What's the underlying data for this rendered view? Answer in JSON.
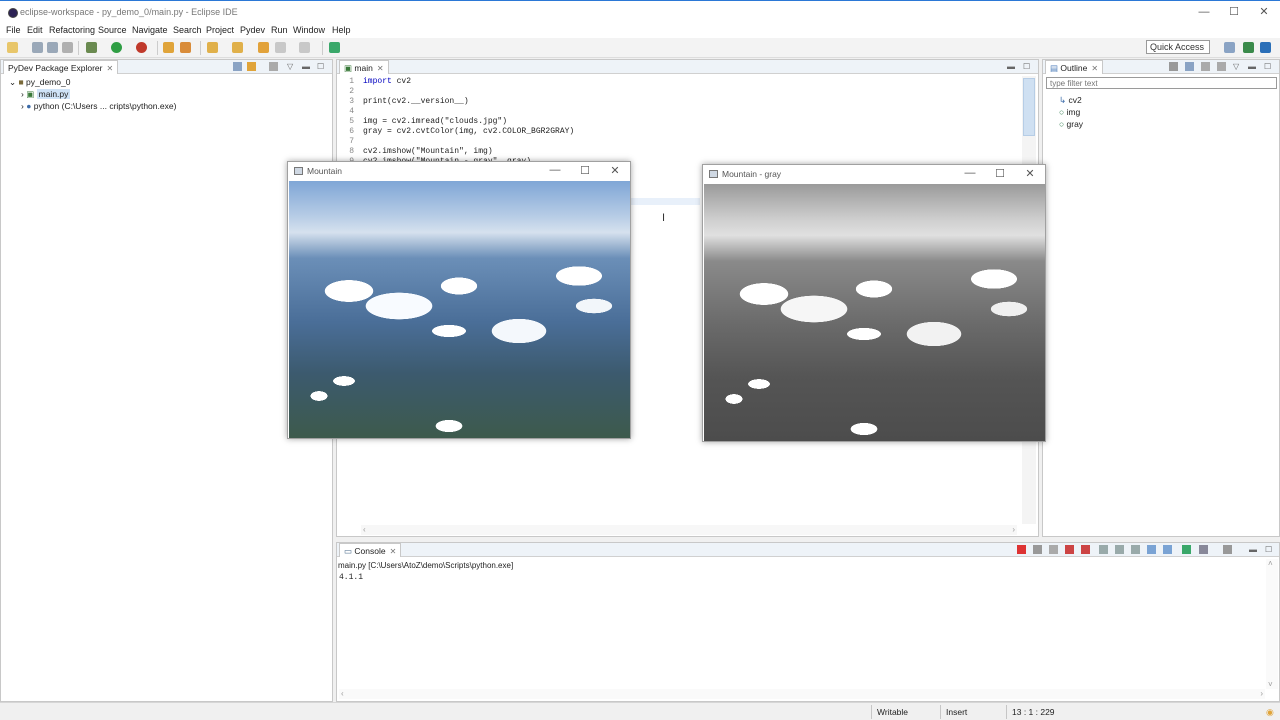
{
  "window": {
    "title": "eclipse-workspace - py_demo_0/main.py - Eclipse IDE",
    "controls": [
      "—",
      "☐",
      "✕"
    ]
  },
  "menu": [
    "File",
    "Edit",
    "Refactoring",
    "Source",
    "Navigate",
    "Search",
    "Project",
    "Pydev",
    "Run",
    "Window",
    "Help"
  ],
  "quick_access": "Quick Access",
  "explorer": {
    "tab_label": "PyDev Package Explorer",
    "tree": [
      {
        "label": "py_demo_0",
        "icon": "project-icon"
      },
      {
        "label": "main.py",
        "icon": "python-file-icon",
        "selected": true
      },
      {
        "label": "python  (C:\\Users ... cripts\\python.exe)",
        "icon": "python-interpreter-icon"
      }
    ]
  },
  "editor": {
    "tab_label": "main",
    "lines": [
      {
        "n": "1",
        "code": "import cv2"
      },
      {
        "n": "2",
        "code": ""
      },
      {
        "n": "3",
        "code": "print(cv2.__version__)"
      },
      {
        "n": "4",
        "code": ""
      },
      {
        "n": "5",
        "code": "img = cv2.imread(\"clouds.jpg\")"
      },
      {
        "n": "6",
        "code": "gray = cv2.cvtColor(img, cv2.COLOR_BGR2GRAY)"
      },
      {
        "n": "7",
        "code": ""
      },
      {
        "n": "8",
        "code": "cv2.imshow(\"Mountain\", img)"
      },
      {
        "n": "9",
        "code": "cv2.imshow(\"Mountain - gray\", gray)"
      }
    ]
  },
  "outline": {
    "tab_label": "Outline",
    "filter_placeholder": "type filter text",
    "items": [
      "cv2",
      "img",
      "gray"
    ]
  },
  "cv_windows": [
    {
      "title": "Mountain",
      "image": "color"
    },
    {
      "title": "Mountain - gray",
      "image": "grayscale"
    }
  ],
  "console": {
    "tab_label": "Console",
    "process": "main.py [C:\\Users\\AtoZ\\demo\\Scripts\\python.exe]",
    "output": "4.1.1"
  },
  "status": {
    "writable": "Writable",
    "mode": "Insert",
    "position": "13 : 1 : 229"
  },
  "colors": {
    "accent": "#2b78d6",
    "keyword": "#0000c0",
    "string": "#2f8f2f",
    "selection": "#cfe3f7"
  }
}
